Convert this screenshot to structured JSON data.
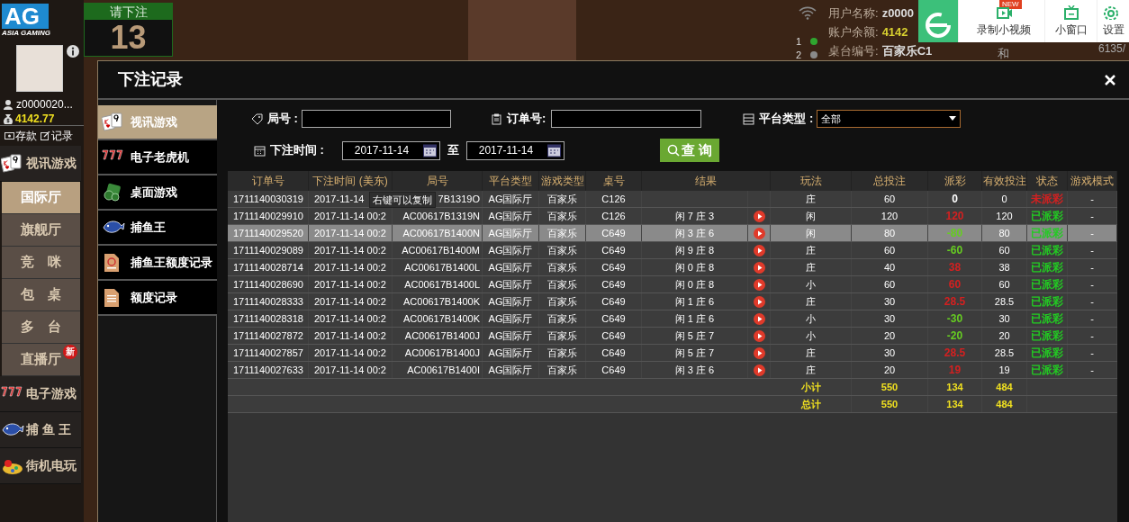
{
  "sidebar": {
    "logo": "AG",
    "logo_sub": "ASIA GAMING",
    "username": "z0000020...",
    "balance": "4142.77",
    "actions": [
      {
        "label": "存款",
        "kind": "deposit"
      },
      {
        "label": "记录",
        "kind": "record"
      }
    ],
    "sections": [
      {
        "label": "视讯游戏",
        "kind": "cards",
        "children": [
          {
            "label": "国际厅",
            "selected": true
          },
          {
            "label": "旗舰厅",
            "selected": false
          },
          {
            "label": "竞　咪",
            "selected": false
          },
          {
            "label": "包　桌",
            "selected": false
          },
          {
            "label": "多　台",
            "selected": false
          },
          {
            "label": "直播厅",
            "selected": false,
            "badge": "新"
          }
        ]
      },
      {
        "label": "电子游戏",
        "kind": "slots"
      },
      {
        "label": "捕 鱼 王",
        "kind": "fish"
      },
      {
        "label": "街机电玩",
        "kind": "arcade"
      }
    ]
  },
  "countdown": {
    "label": "请下注",
    "value": "13"
  },
  "table_info": {
    "roads": [
      {
        "label": "1",
        "color": "#2fa52f"
      },
      {
        "label": "2",
        "color": "#8a8a8a"
      }
    ],
    "rows": [
      {
        "label": "用户名称:",
        "value": "z0000"
      },
      {
        "label": "账户余额:",
        "value": "4142"
      },
      {
        "label": "桌台编号:",
        "value": "百家乐C1"
      }
    ],
    "result_label": "和",
    "score": "6135/"
  },
  "widget": {
    "badge": "NEW",
    "buttons": [
      {
        "label": "录制小视频",
        "kind": "record"
      },
      {
        "label": "小窗口",
        "kind": "tv"
      },
      {
        "label": "设置",
        "kind": "settings"
      }
    ]
  },
  "dialog": {
    "title": "下注记录",
    "nav": [
      {
        "label": "视讯游戏",
        "kind": "cards",
        "selected": true
      },
      {
        "label": "电子老虎机",
        "kind": "slots",
        "selected": false
      },
      {
        "label": "桌面游戏",
        "kind": "chips",
        "selected": false
      },
      {
        "label": "捕鱼王",
        "kind": "fish",
        "selected": false
      },
      {
        "label": "捕鱼王额度记录",
        "kind": "doc-red",
        "selected": false
      },
      {
        "label": "额度记录",
        "kind": "doc",
        "selected": false
      }
    ],
    "filters": {
      "round_label": "局号 :",
      "order_label": "订单号:",
      "platform_label": "平台类型 :",
      "platform_value": "全部",
      "time_label": "下注时间 :",
      "date_from": "2017-11-14",
      "to_label": "至",
      "date_to": "2017-11-14",
      "query_button": "查 询"
    },
    "table": {
      "columns": [
        "订单号",
        "下注时间 (美东)",
        "局号",
        "平台类型",
        "游戏类型",
        "桌号",
        "结果",
        "玩法",
        "总投注",
        "派彩",
        "有效投注",
        "状态",
        "游戏模式"
      ],
      "rows": [
        {
          "order": "1711140030319",
          "time": "2017-11-14",
          "round": "7B1319O",
          "platform": "AG国际厅",
          "game": "百家乐",
          "table": "C126",
          "replay": false,
          "play": "庄",
          "total": "60",
          "payout": {
            "text": "0",
            "kind": "zero"
          },
          "valid": "0",
          "status": {
            "text": "未派彩",
            "paid": false
          },
          "mode": "-",
          "selected": false
        },
        {
          "order": "1711140029910",
          "time": "2017-11-14 00:2",
          "round": "AC00617B1319N",
          "platform": "AG国际厅",
          "game": "百家乐",
          "table": "C126",
          "result": "闲 7 庄 3",
          "replay": true,
          "play": "闲",
          "total": "120",
          "payout": {
            "text": "120",
            "kind": "win"
          },
          "valid": "120",
          "status": {
            "text": "已派彩",
            "paid": true
          },
          "mode": "-",
          "selected": false
        },
        {
          "order": "1711140029520",
          "time": "2017-11-14 00:2",
          "round": "AC00617B1400N",
          "platform": "AG国际厅",
          "game": "百家乐",
          "table": "C649",
          "result": "闲 3 庄 6",
          "replay": true,
          "play": "闲",
          "total": "80",
          "payout": {
            "text": "-80",
            "kind": "loss"
          },
          "valid": "80",
          "status": {
            "text": "已派彩",
            "paid": true
          },
          "mode": "-",
          "selected": true
        },
        {
          "order": "1711140029089",
          "time": "2017-11-14 00:2",
          "round": "AC00617B1400M",
          "platform": "AG国际厅",
          "game": "百家乐",
          "table": "C649",
          "result": "闲 9 庄 8",
          "replay": true,
          "play": "庄",
          "total": "60",
          "payout": {
            "text": "-60",
            "kind": "loss"
          },
          "valid": "60",
          "status": {
            "text": "已派彩",
            "paid": true
          },
          "mode": "-",
          "selected": false
        },
        {
          "order": "1711140028714",
          "time": "2017-11-14 00:2",
          "round": "AC00617B1400L",
          "platform": "AG国际厅",
          "game": "百家乐",
          "table": "C649",
          "result": "闲 0 庄 8",
          "replay": true,
          "play": "庄",
          "total": "40",
          "payout": {
            "text": "38",
            "kind": "win"
          },
          "valid": "38",
          "status": {
            "text": "已派彩",
            "paid": true
          },
          "mode": "-",
          "selected": false
        },
        {
          "order": "1711140028690",
          "time": "2017-11-14 00:2",
          "round": "AC00617B1400L",
          "platform": "AG国际厅",
          "game": "百家乐",
          "table": "C649",
          "result": "闲 0 庄 8",
          "replay": true,
          "play": "小",
          "total": "60",
          "payout": {
            "text": "60",
            "kind": "win"
          },
          "valid": "60",
          "status": {
            "text": "已派彩",
            "paid": true
          },
          "mode": "-",
          "selected": false
        },
        {
          "order": "1711140028333",
          "time": "2017-11-14 00:2",
          "round": "AC00617B1400K",
          "platform": "AG国际厅",
          "game": "百家乐",
          "table": "C649",
          "result": "闲 1 庄 6",
          "replay": true,
          "play": "庄",
          "total": "30",
          "payout": {
            "text": "28.5",
            "kind": "win"
          },
          "valid": "28.5",
          "status": {
            "text": "已派彩",
            "paid": true
          },
          "mode": "-",
          "selected": false
        },
        {
          "order": "1711140028318",
          "time": "2017-11-14 00:2",
          "round": "AC00617B1400K",
          "platform": "AG国际厅",
          "game": "百家乐",
          "table": "C649",
          "result": "闲 1 庄 6",
          "replay": true,
          "play": "小",
          "total": "30",
          "payout": {
            "text": "-30",
            "kind": "loss"
          },
          "valid": "30",
          "status": {
            "text": "已派彩",
            "paid": true
          },
          "mode": "-",
          "selected": false
        },
        {
          "order": "1711140027872",
          "time": "2017-11-14 00:2",
          "round": "AC00617B1400J",
          "platform": "AG国际厅",
          "game": "百家乐",
          "table": "C649",
          "result": "闲 5 庄 7",
          "replay": true,
          "play": "小",
          "total": "20",
          "payout": {
            "text": "-20",
            "kind": "loss"
          },
          "valid": "20",
          "status": {
            "text": "已派彩",
            "paid": true
          },
          "mode": "-",
          "selected": false
        },
        {
          "order": "1711140027857",
          "time": "2017-11-14 00:2",
          "round": "AC00617B1400J",
          "platform": "AG国际厅",
          "game": "百家乐",
          "table": "C649",
          "result": "闲 5 庄 7",
          "replay": true,
          "play": "庄",
          "total": "30",
          "payout": {
            "text": "28.5",
            "kind": "win"
          },
          "valid": "28.5",
          "status": {
            "text": "已派彩",
            "paid": true
          },
          "mode": "-",
          "selected": false
        },
        {
          "order": "1711140027633",
          "time": "2017-11-14 00:2",
          "round": "AC00617B1400I",
          "platform": "AG国际厅",
          "game": "百家乐",
          "table": "C649",
          "result": "闲 3 庄 6",
          "replay": true,
          "play": "庄",
          "total": "20",
          "payout": {
            "text": "19",
            "kind": "win"
          },
          "valid": "19",
          "status": {
            "text": "已派彩",
            "paid": true
          },
          "mode": "-",
          "selected": false
        }
      ],
      "summary": [
        {
          "label": "小计",
          "total": "550",
          "payout": "134",
          "valid": "484"
        },
        {
          "label": "总计",
          "total": "550",
          "payout": "134",
          "valid": "484"
        }
      ]
    },
    "tooltip": "右键可以复制"
  }
}
